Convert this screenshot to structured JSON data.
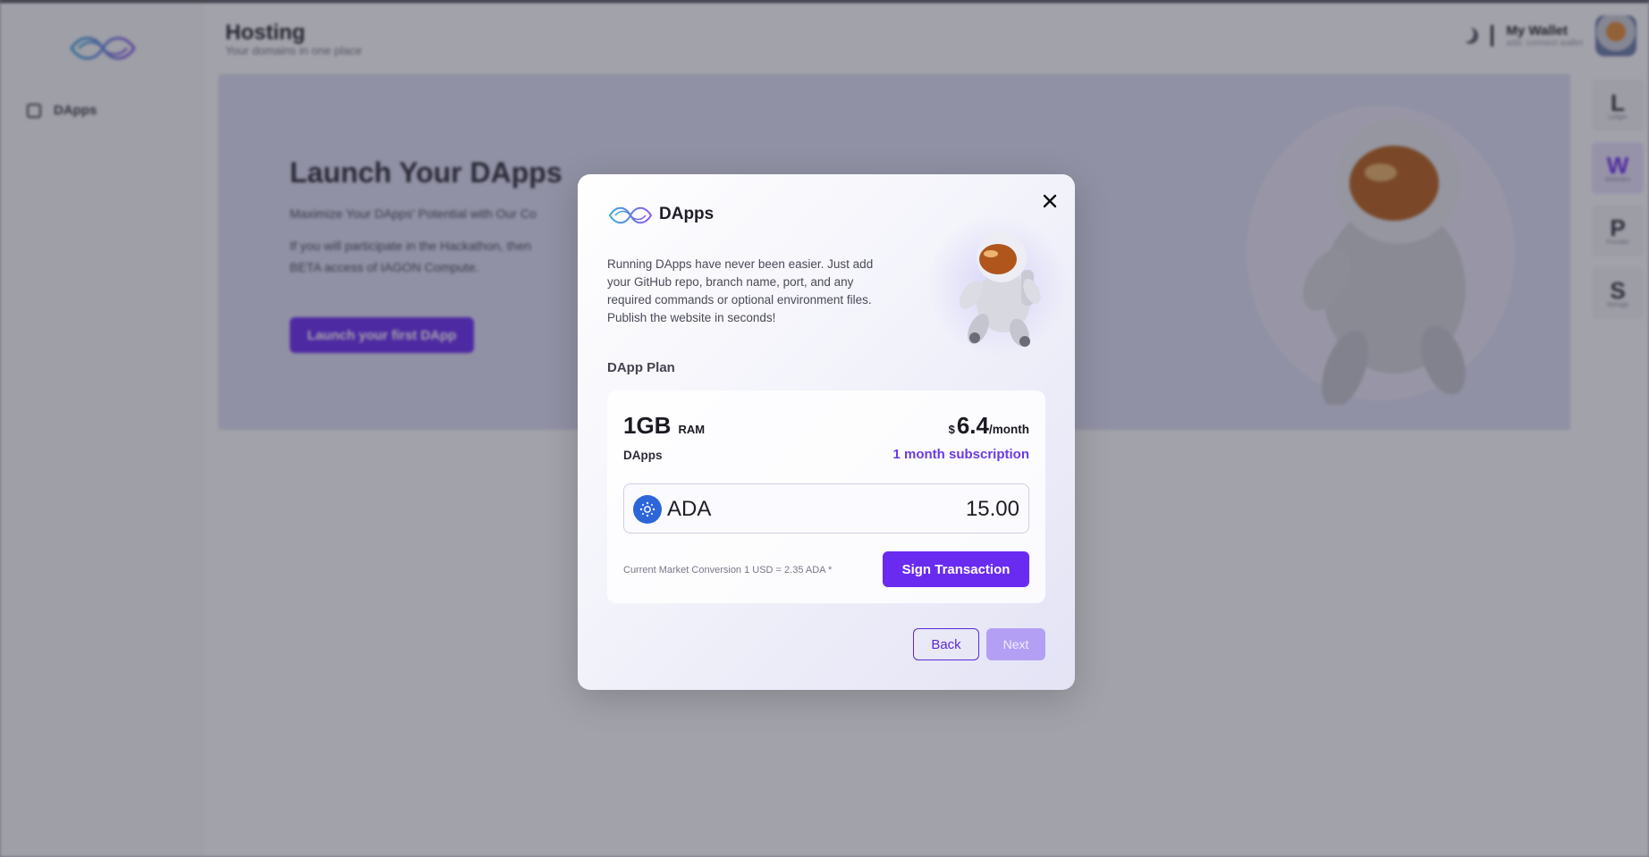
{
  "app": {
    "sidebar": {
      "items": [
        {
          "label": "DApps"
        }
      ]
    },
    "header": {
      "title": "Hosting",
      "subtitle": "Your domains in one place",
      "wallet_title": "My Wallet",
      "wallet_sub": "add. connect wallet"
    },
    "hero": {
      "title": "Launch Your DApps",
      "line1": "Maximize Your DApps' Potential with Our Co",
      "line2": "If you will participate in the Hackathon, then",
      "line3": "BETA access of IAGON Compute.",
      "button": "Launch your first DApp"
    },
    "rail": [
      {
        "letter": "L",
        "label": "Ledger"
      },
      {
        "letter": "W",
        "label": "Websites"
      },
      {
        "letter": "P",
        "label": "Provider"
      },
      {
        "letter": "S",
        "label": "Storage"
      }
    ]
  },
  "modal": {
    "title": "DApps",
    "description": "Running DApps have never been easier. Just add your GitHub repo, branch name, port, and any required commands or optional environment files. Publish the website in seconds!",
    "plan_label": "DApp Plan",
    "plan": {
      "ram_value": "1GB",
      "ram_unit": "RAM",
      "type": "DApps",
      "currency_symbol": "$",
      "price": "6.4",
      "period": "/month",
      "subscription": "1 month subscription"
    },
    "payment": {
      "token": "ADA",
      "amount": "15.00"
    },
    "conversion_note": "Current Market Conversion 1 USD = 2.35 ADA *",
    "sign_button": "Sign Transaction",
    "back_button": "Back",
    "next_button": "Next"
  },
  "colors": {
    "accent": "#6a2bf0",
    "link": "#6a3be6",
    "ada_blue": "#2e66d9",
    "next_disabled": "#b3a0f5"
  },
  "icons": [
    "logo-icon",
    "close-icon",
    "ada-token-icon",
    "moon-icon",
    "avatar",
    "astronaut-illustration"
  ]
}
